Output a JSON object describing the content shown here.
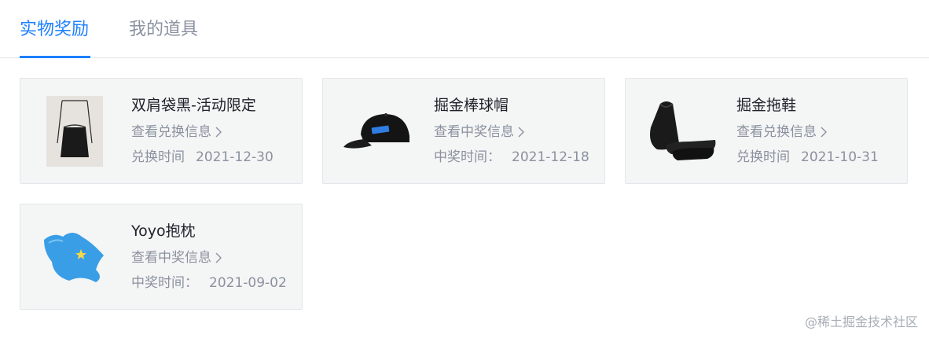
{
  "tabs": [
    {
      "label": "实物奖励",
      "active": true
    },
    {
      "label": "我的道具",
      "active": false
    }
  ],
  "cards": [
    {
      "name": "双肩袋黑-活动限定",
      "link": "查看兑换信息",
      "time_label": "兑换时间",
      "time_sep": " ",
      "date": "2021-12-30",
      "icon": "backpack-image"
    },
    {
      "name": "掘金棒球帽",
      "link": "查看中奖信息",
      "time_label": "中奖时间：",
      "time_sep": "  ",
      "date": "2021-12-18",
      "icon": "cap-image"
    },
    {
      "name": "掘金拖鞋",
      "link": "查看兑换信息",
      "time_label": "兑换时间",
      "time_sep": " ",
      "date": "2021-10-31",
      "icon": "slippers-image"
    },
    {
      "name": "Yoyo抱枕",
      "link": "查看中奖信息",
      "time_label": "中奖时间：",
      "time_sep": "  ",
      "date": "2021-09-02",
      "icon": "pillow-image"
    }
  ],
  "watermark": "@稀土掘金技术社区",
  "colors": {
    "accent": "#1e80ff",
    "muted": "#8a919f",
    "card_bg": "#f4f5f5"
  }
}
